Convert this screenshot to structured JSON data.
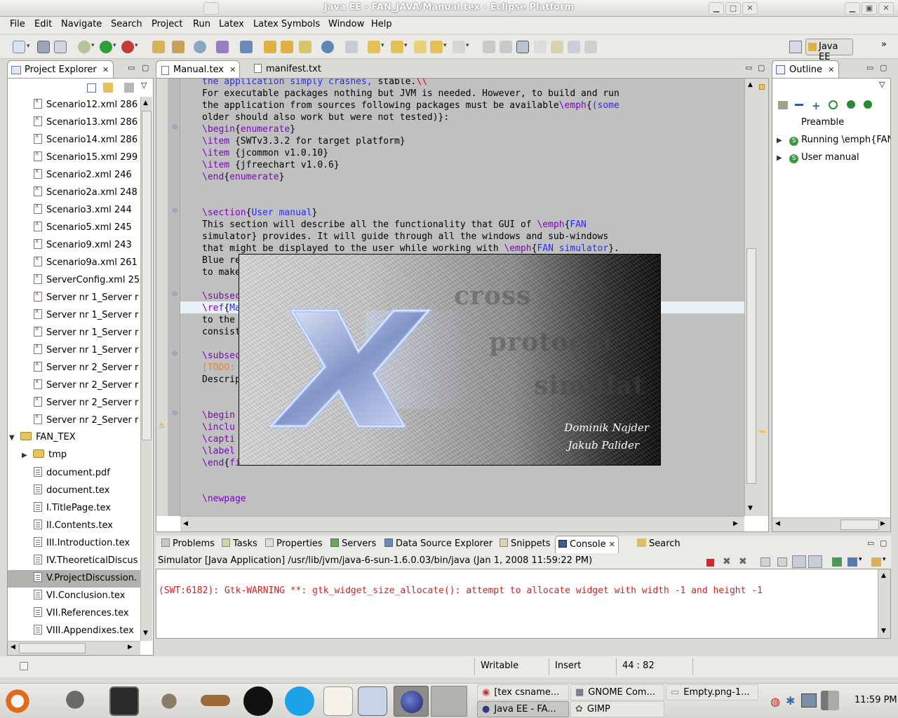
{
  "window": {
    "title": "Java EE - FAN_JAVA/Manual.tex - Eclipse Platform"
  },
  "menu": [
    "File",
    "Edit",
    "Navigate",
    "Search",
    "Project",
    "Run",
    "Latex",
    "Latex Symbols",
    "Window",
    "Help"
  ],
  "perspective": {
    "label": "Java EE"
  },
  "project_explorer": {
    "title": "Project Explorer",
    "items": [
      "Scenario12.xml 286",
      "Scenario13.xml 286",
      "Scenario14.xml 286",
      "Scenario15.xml 299",
      "Scenario2.xml 246",
      "Scenario2a.xml 248",
      "Scenario3.xml 244",
      "Scenario5.xml 245",
      "Scenario9.xml 243",
      "Scenario9a.xml 261",
      "ServerConfig.xml 25",
      "Server nr 1_Server r",
      "Server nr 1_Server r",
      "Server nr 1_Server r",
      "Server nr 1_Server r",
      "Server nr 2_Server r",
      "Server nr 2_Server r",
      "Server nr 2_Server r",
      "Server nr 2_Server r"
    ],
    "folder": "FAN_TEX",
    "subfolder": "tmp",
    "tex_items": [
      "document.pdf",
      "document.tex",
      "I.TitlePage.tex",
      "II.Contents.tex",
      "III.Introduction.tex",
      "IV.TheoreticalDiscus",
      "V.ProjectDiscussion.",
      "VI.Conclusion.tex",
      "VII.References.tex",
      "VIII.Appendixes.tex"
    ]
  },
  "editor": {
    "tabs": [
      "Manual.tex",
      "manifest.txt"
    ],
    "lines": [
      "the application simply crashes, stable.\\\\",
      "For executable packages nothing but JVM is needed. However, to build and run",
      "the application from sources following packages must be available\\emph{(some",
      "older should also work but were not tested)}:",
      "\\begin{enumerate}",
      "\\item {SWTv3.3.2 for target platform}",
      "\\item {jcommon v1.0.10}",
      "\\item {jfreechart v1.0.6}",
      "\\end{enumerate}",
      "",
      "",
      "\\section{User manual}",
      "This section will describe all the functionality that GUI of \\emph{FAN",
      "simulator} provides. It will guide through all the windows and sub-windows",
      "that might be displayed to the user while working with \\emph{FAN simulator}.",
      "Blue re",
      "to make",
      "",
      "\\subsec",
      "\\ref{Ma",
      "to the",
      "consist",
      "",
      "\\subsec",
      "[TODO:",
      "Descrip",
      "",
      "",
      "\\begin",
      "\\inclu",
      "\\capti",
      "\\label",
      "\\end{fi",
      "",
      "",
      "\\newpage"
    ]
  },
  "splash": {
    "faint_words": [
      "cross",
      "protocol",
      "simulat"
    ],
    "authors": [
      "Dominik Najder",
      "Jakub Palider"
    ]
  },
  "outline": {
    "title": "Outline",
    "items": [
      "Preamble",
      "Running \\emph{FAN",
      "User manual"
    ]
  },
  "bottom": {
    "tabs": [
      "Problems",
      "Tasks",
      "Properties",
      "Servers",
      "Data Source Explorer",
      "Snippets",
      "Console",
      "Search"
    ],
    "console_header": "Simulator [Java Application] /usr/lib/jvm/java-6-sun-1.6.0.03/bin/java (Jan 1, 2008 11:59:22 PM)",
    "console_output": "(SWT:6182): Gtk-WARNING **: gtk_widget_size_allocate(): attempt to allocate widget with width -1 and height -1"
  },
  "status": {
    "mode": "Writable",
    "insert": "Insert",
    "position": "44 : 82"
  },
  "taskbar": {
    "tasks": [
      "[tex csname...",
      "GNOME Com...",
      "Empty.png-1...",
      "Java EE - FA...",
      "GIMP"
    ],
    "clock": "11:59 PM"
  },
  "colors": {
    "keyword": "#7f00c2",
    "argument": "#2a2aff",
    "todo": "#e8862d",
    "console_error": "#d62020",
    "editor_bg": "#c0c0c0"
  }
}
